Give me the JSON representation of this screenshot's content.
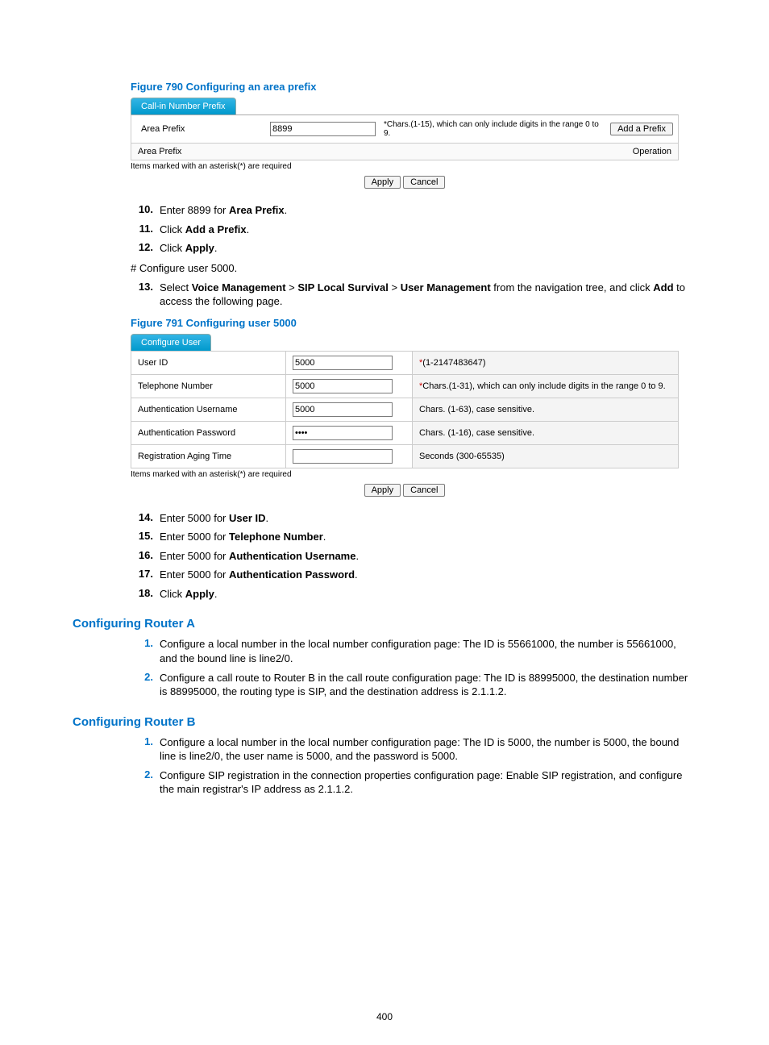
{
  "page_number": "400",
  "fig790": {
    "title": "Figure 790 Configuring an area prefix",
    "tab": "Call-in Number Prefix",
    "label_area_prefix": "Area Prefix",
    "value_area_prefix": "8899",
    "hint_area_prefix": "*Chars.(1-15), which can only include digits in the range 0 to 9.",
    "btn_add_prefix": "Add a Prefix",
    "header_area_prefix": "Area Prefix",
    "header_operation": "Operation",
    "footnote": "Items marked with an asterisk(*) are required",
    "btn_apply": "Apply",
    "btn_cancel": "Cancel"
  },
  "step10": {
    "num": "10.",
    "pre": "Enter 8899 for ",
    "bold": "Area Prefix",
    "post": "."
  },
  "step11": {
    "num": "11.",
    "pre": "Click ",
    "bold": "Add a Prefix",
    "post": "."
  },
  "step12": {
    "num": "12.",
    "pre": "Click ",
    "bold": "Apply",
    "post": "."
  },
  "cfg5000": "# Configure user 5000.",
  "step13": {
    "num": "13.",
    "pre": "Select ",
    "b1": "Voice Management",
    "gt1": " > ",
    "b2": "SIP Local Survival",
    "gt2": " > ",
    "b3": "User Management",
    "mid": " from the navigation tree, and click ",
    "b4": "Add",
    "post": " to access the following page."
  },
  "fig791": {
    "title": "Figure 791 Configuring user 5000",
    "tab": "Configure User",
    "rows": [
      {
        "label": "User ID",
        "value": "5000",
        "type": "text",
        "hint_star": "*",
        "hint": "(1-2147483647)"
      },
      {
        "label": "Telephone Number",
        "value": "5000",
        "type": "text",
        "hint_star": "*",
        "hint": "Chars.(1-31), which can only include digits in the range 0 to 9."
      },
      {
        "label": "Authentication Username",
        "value": "5000",
        "type": "text",
        "hint_star": "",
        "hint": "Chars. (1-63), case sensitive."
      },
      {
        "label": "Authentication Password",
        "value": "••••",
        "type": "password",
        "hint_star": "",
        "hint": "Chars. (1-16), case sensitive."
      },
      {
        "label": "Registration Aging Time",
        "value": "",
        "type": "text",
        "hint_star": "",
        "hint": "Seconds (300-65535)"
      }
    ],
    "footnote": "Items marked with an asterisk(*) are required",
    "btn_apply": "Apply",
    "btn_cancel": "Cancel"
  },
  "step14": {
    "num": "14.",
    "pre": "Enter 5000 for ",
    "bold": "User ID",
    "post": "."
  },
  "step15": {
    "num": "15.",
    "pre": "Enter 5000 for ",
    "bold": "Telephone Number",
    "post": "."
  },
  "step16": {
    "num": "16.",
    "pre": "Enter 5000 for ",
    "bold": "Authentication Username",
    "post": "."
  },
  "step17": {
    "num": "17.",
    "pre": "Enter 5000 for ",
    "bold": "Authentication Password",
    "post": "."
  },
  "step18": {
    "num": "18.",
    "pre": "Click ",
    "bold": "Apply",
    "post": "."
  },
  "routerA": {
    "heading": "Configuring Router A",
    "s1": {
      "num": "1.",
      "txt": "Configure a local number in the local number configuration page: The ID is 55661000, the number is 55661000, and the bound line is line2/0."
    },
    "s2": {
      "num": "2.",
      "txt": "Configure a call route to Router B in the call route configuration page: The ID is 88995000, the destination number is 88995000, the routing type is SIP, and the destination address is 2.1.1.2."
    }
  },
  "routerB": {
    "heading": "Configuring Router B",
    "s1": {
      "num": "1.",
      "txt": "Configure a local number in the local number configuration page: The ID is 5000, the number is 5000, the bound line is line2/0, the user name is 5000, and the password is 5000."
    },
    "s2": {
      "num": "2.",
      "txt": "Configure SIP registration in the connection properties configuration page: Enable SIP registration, and configure the main registrar's IP address as 2.1.1.2."
    }
  }
}
